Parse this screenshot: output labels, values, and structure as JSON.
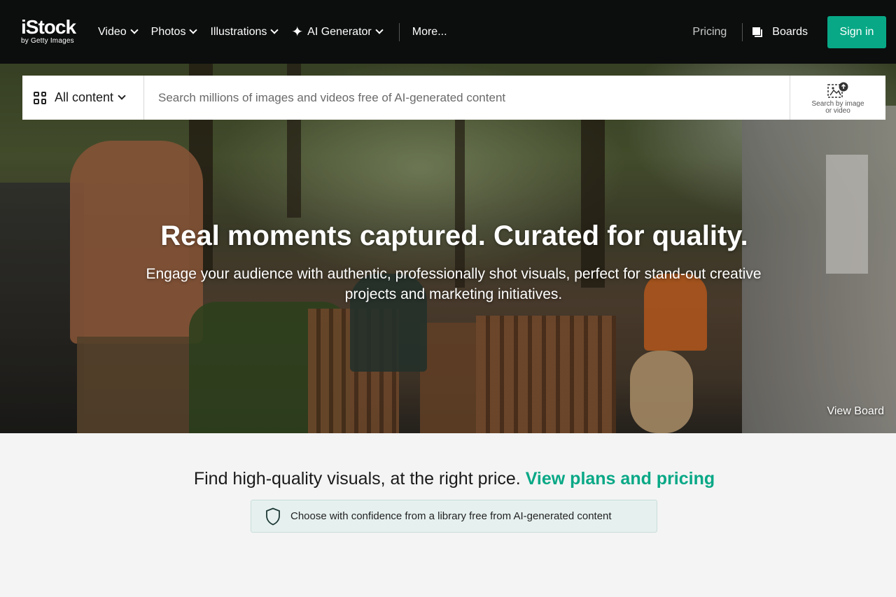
{
  "brand": {
    "logo_main": "iStock",
    "logo_sub": "by Getty Images"
  },
  "nav": {
    "items": [
      {
        "label": "Video"
      },
      {
        "label": "Photos"
      },
      {
        "label": "Illustrations"
      },
      {
        "label": "AI Generator"
      }
    ],
    "more": "More...",
    "pricing": "Pricing",
    "boards": "Boards",
    "signin": "Sign in"
  },
  "search": {
    "content_type": "All content",
    "placeholder": "Search millions of images and videos free of AI-generated content",
    "visual_search_label_1": "Search by image",
    "visual_search_label_2": "or video"
  },
  "hero": {
    "title": "Real moments captured. Curated for quality.",
    "subtitle": "Engage your audience with authentic, professionally shot visuals, perfect for stand-out creative projects and marketing initiatives.",
    "view_board": "View Board"
  },
  "promo": {
    "text": "Find high-quality visuals, at the right price.",
    "link": "View plans and pricing"
  },
  "badge": {
    "text": "Choose with confidence from a library free from AI-generated content"
  },
  "colors": {
    "accent": "#08a886",
    "nav_bg": "#0c0d0d",
    "badge_bg": "#e6f1ef"
  }
}
